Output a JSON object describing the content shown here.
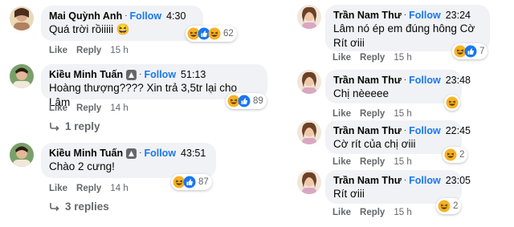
{
  "colors": {
    "bubble": "#f0f2f5",
    "follow": "#1877f2",
    "meta": "#65676b",
    "haha": "#f7b125",
    "like": "#1877f2"
  },
  "left": [
    {
      "name": "Mai Quỳnh Anh",
      "follow": "Follow",
      "time": "4:30",
      "text": "Quá trời rồiiiii 😆",
      "like": "Like",
      "reply": "Reply",
      "ago": "15 h",
      "reactions": [
        "haha-icon",
        "like-icon",
        "haha-icon"
      ],
      "count": "62"
    },
    {
      "name": "Kiều Minh Tuấn",
      "follow": "Follow",
      "time": "51:13",
      "text": "Hoàng thượng???? Xin trả 3,5tr lại cho Lâm",
      "like": "Like",
      "reply": "Reply",
      "ago": "14 h",
      "reactions": [
        "haha-icon",
        "like-icon"
      ],
      "count": "89",
      "replies": "1 reply"
    },
    {
      "name": "Kiều Minh Tuấn",
      "follow": "Follow",
      "time": "43:51",
      "text": "Chào 2 cưng!",
      "like": "Like",
      "reply": "Reply",
      "ago": "14 h",
      "reactions": [
        "haha-icon",
        "like-icon"
      ],
      "count": "87",
      "replies": "3 replies"
    }
  ],
  "right": [
    {
      "name": "Trần Nam Thư",
      "follow": "Follow",
      "time": "23:24",
      "text_line1": "Lâm nó ép em đúng hông Cờ",
      "text_line2": "Rít ơiii",
      "like": "Like",
      "reply": "Reply",
      "ago": "15 h",
      "reactions": [
        "haha-icon",
        "like-icon"
      ],
      "count": "7"
    },
    {
      "name": "Trần Nam Thư",
      "follow": "Follow",
      "time": "23:48",
      "text": "Chị nèeeee",
      "like": "Like",
      "reply": "Reply",
      "ago": "15 h",
      "reactions": [
        "haha-icon"
      ],
      "count": ""
    },
    {
      "name": "Trần Nam Thư",
      "follow": "Follow",
      "time": "22:45",
      "text": "Cờ rít của chị ơiii",
      "like": "Like",
      "reply": "Reply",
      "ago": "15 h",
      "reactions": [
        "haha-icon"
      ],
      "count": "2"
    },
    {
      "name": "Trần Nam Thư",
      "follow": "Follow",
      "time": "23:05",
      "text": "Rít ơiii",
      "like": "Like",
      "reply": "Reply",
      "ago": "15 h",
      "reactions": [
        "haha-icon"
      ],
      "count": "2"
    }
  ]
}
